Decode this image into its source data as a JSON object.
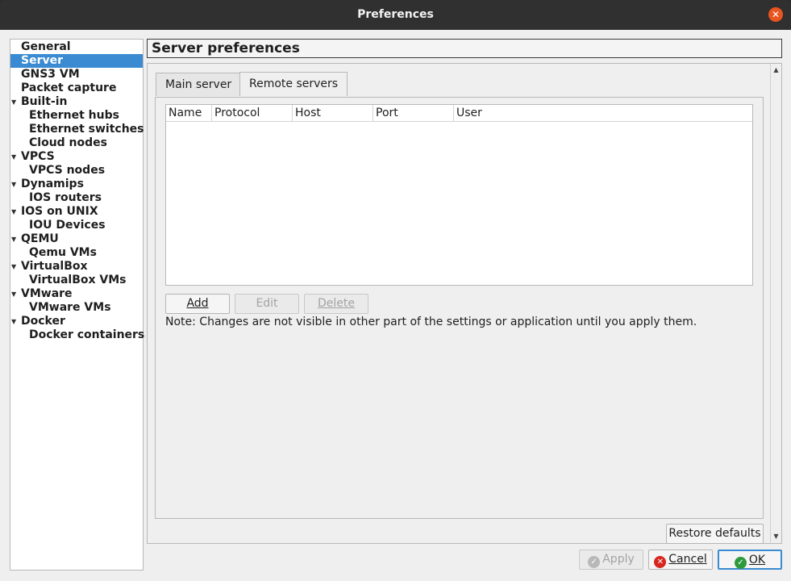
{
  "window": {
    "title": "Preferences"
  },
  "sidebar": {
    "items": [
      {
        "label": "General",
        "level": 0,
        "expandable": false,
        "selected": false
      },
      {
        "label": "Server",
        "level": 0,
        "expandable": false,
        "selected": true
      },
      {
        "label": "GNS3 VM",
        "level": 0,
        "expandable": false,
        "selected": false
      },
      {
        "label": "Packet capture",
        "level": 0,
        "expandable": false,
        "selected": false
      },
      {
        "label": "Built-in",
        "level": 0,
        "expandable": true,
        "selected": false
      },
      {
        "label": "Ethernet hubs",
        "level": 1,
        "expandable": false,
        "selected": false
      },
      {
        "label": "Ethernet switches",
        "level": 1,
        "expandable": false,
        "selected": false
      },
      {
        "label": "Cloud nodes",
        "level": 1,
        "expandable": false,
        "selected": false
      },
      {
        "label": "VPCS",
        "level": 0,
        "expandable": true,
        "selected": false
      },
      {
        "label": "VPCS nodes",
        "level": 1,
        "expandable": false,
        "selected": false
      },
      {
        "label": "Dynamips",
        "level": 0,
        "expandable": true,
        "selected": false
      },
      {
        "label": "IOS routers",
        "level": 1,
        "expandable": false,
        "selected": false
      },
      {
        "label": "IOS on UNIX",
        "level": 0,
        "expandable": true,
        "selected": false
      },
      {
        "label": "IOU Devices",
        "level": 1,
        "expandable": false,
        "selected": false
      },
      {
        "label": "QEMU",
        "level": 0,
        "expandable": true,
        "selected": false
      },
      {
        "label": "Qemu VMs",
        "level": 1,
        "expandable": false,
        "selected": false
      },
      {
        "label": "VirtualBox",
        "level": 0,
        "expandable": true,
        "selected": false
      },
      {
        "label": "VirtualBox VMs",
        "level": 1,
        "expandable": false,
        "selected": false
      },
      {
        "label": "VMware",
        "level": 0,
        "expandable": true,
        "selected": false
      },
      {
        "label": "VMware VMs",
        "level": 1,
        "expandable": false,
        "selected": false
      },
      {
        "label": "Docker",
        "level": 0,
        "expandable": true,
        "selected": false
      },
      {
        "label": "Docker containers",
        "level": 1,
        "expandable": false,
        "selected": false
      }
    ]
  },
  "panel": {
    "title": "Server preferences",
    "tabs": [
      {
        "label": "Main server",
        "active": false
      },
      {
        "label": "Remote servers",
        "active": true
      }
    ],
    "table": {
      "columns": [
        "Name",
        "Protocol",
        "Host",
        "Port",
        "User"
      ],
      "rows": []
    },
    "buttons": {
      "add": "Add",
      "edit": "Edit",
      "delete": "Delete"
    },
    "note": "Note: Changes are not visible in other part of the settings or application until you apply them.",
    "restore_defaults": "Restore defaults"
  },
  "footer": {
    "apply": "Apply",
    "cancel": "Cancel",
    "ok": "OK"
  },
  "colors": {
    "selection": "#3a8bd1",
    "close_button": "#e95420",
    "titlebar": "#303030"
  }
}
